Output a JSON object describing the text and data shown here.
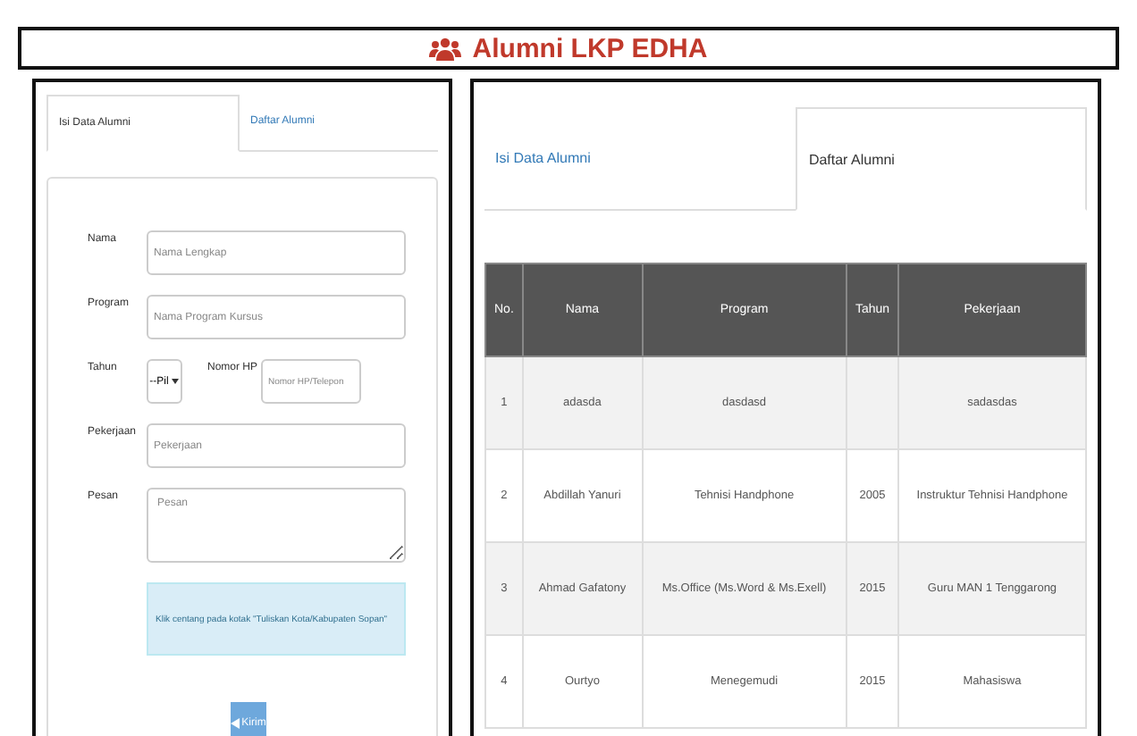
{
  "header": {
    "title": "Alumni LKP EDHA"
  },
  "form_panel": {
    "tabs": [
      {
        "label": "Isi Data Alumni",
        "selected": true
      },
      {
        "label": "Daftar Alumni",
        "selected": false
      }
    ],
    "fields": [
      {
        "kind": "text",
        "label": "Nama",
        "placeholder": "Nama Lengkap"
      },
      {
        "kind": "text",
        "label": "Program",
        "placeholder": "Nama Program Kursus"
      },
      {
        "kind": "pair",
        "label": "Tahun",
        "value": "--Pil",
        "label_2": "Nomor HP",
        "placeholder": "Nomor HP/Telepon"
      },
      {
        "kind": "text",
        "label": "Pekerjaan",
        "placeholder": "Pekerjaan"
      },
      {
        "kind": "textarea",
        "label": "Pesan",
        "placeholder": "Pesan"
      }
    ],
    "notice": "Klik centang pada kotak \"Tuliskan Kota/Kabupaten Sopan\"",
    "submit": "Kirim"
  },
  "list_panel": {
    "tabs": [
      {
        "label": "Isi Data Alumni",
        "selected": false
      },
      {
        "label": "Daftar Alumni",
        "selected": true
      }
    ],
    "table": {
      "columns": [
        "No.",
        "Nama",
        "Program",
        "Tahun",
        "Pekerjaan"
      ],
      "rows": [
        [
          "1",
          "adasda",
          "dasdasd",
          "",
          "sadasdas"
        ],
        [
          "2",
          "Abdillah Yanuri",
          "Tehnisi Handphone",
          "2005",
          "Instruktur Tehnisi Handphone"
        ],
        [
          "3",
          "Ahmad Gafatony",
          "Ms.Office (Ms.Word & Ms.Exell)",
          "2015",
          "Guru MAN 1 Tenggarong"
        ],
        [
          "4",
          "Ourtyo",
          "Menegemudi",
          "2015",
          "Mahasiswa"
        ]
      ]
    }
  }
}
